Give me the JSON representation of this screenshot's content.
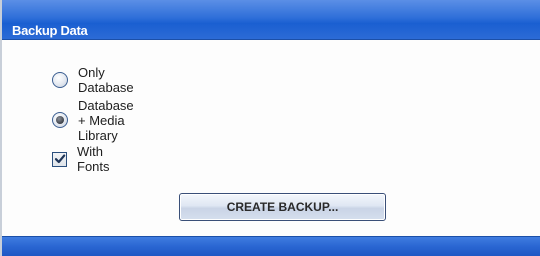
{
  "panel": {
    "title": "Backup Data"
  },
  "options": {
    "only_database": {
      "label": "Only Database",
      "selected": false
    },
    "database_media": {
      "label": "Database + Media Library",
      "selected": true
    },
    "with_fonts": {
      "label": "With Fonts",
      "checked": true
    }
  },
  "actions": {
    "create_backup_label": "CREATE BACKUP..."
  },
  "colors": {
    "header_blue": "#2f6fd9",
    "footer_blue": "#2a66d2",
    "button_border": "#3a4f78"
  }
}
